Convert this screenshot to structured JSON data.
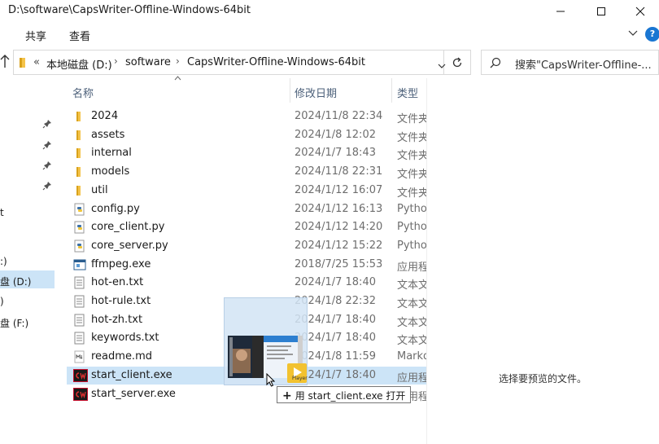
{
  "window": {
    "title": "D:\\software\\CapsWriter-Offline-Windows-64bit"
  },
  "ribbon": {
    "tabs": [
      "共享",
      "查看"
    ],
    "help": "?"
  },
  "address": {
    "overflow": "«",
    "crumbs": [
      "本地磁盘 (D:)",
      "software",
      "CapsWriter-Offline-Windows-64bit"
    ]
  },
  "search": {
    "placeholder": "搜索\"CapsWriter-Offline-..."
  },
  "nav": {
    "items": [
      {
        "label": "t"
      },
      {
        "label": ":)"
      },
      {
        "label": "盘 (D:)"
      },
      {
        "label": ")"
      },
      {
        "label": "盘 (F:)"
      }
    ]
  },
  "columns": {
    "name": "名称",
    "date": "修改日期",
    "type": "类型"
  },
  "files": [
    {
      "name": "2024",
      "date": "2024/11/8 22:34",
      "type": "文件夹",
      "icon": "folder-icon"
    },
    {
      "name": "assets",
      "date": "2024/1/8 12:02",
      "type": "文件夹",
      "icon": "folder-icon"
    },
    {
      "name": "internal",
      "date": "2024/1/7 18:43",
      "type": "文件夹",
      "icon": "folder-icon"
    },
    {
      "name": "models",
      "date": "2024/11/8 22:31",
      "type": "文件夹",
      "icon": "folder-icon"
    },
    {
      "name": "util",
      "date": "2024/1/12 16:07",
      "type": "文件夹",
      "icon": "folder-icon"
    },
    {
      "name": "config.py",
      "date": "2024/1/12 16:13",
      "type": "Python",
      "icon": "python-file-icon"
    },
    {
      "name": "core_client.py",
      "date": "2024/1/12 14:20",
      "type": "Python",
      "icon": "python-file-icon"
    },
    {
      "name": "core_server.py",
      "date": "2024/1/12 15:22",
      "type": "Python",
      "icon": "python-file-icon"
    },
    {
      "name": "ffmpeg.exe",
      "date": "2018/7/25 15:53",
      "type": "应用程序",
      "icon": "exe-window-icon"
    },
    {
      "name": "hot-en.txt",
      "date": "2024/1/7 18:40",
      "type": "文本文档",
      "icon": "text-file-icon"
    },
    {
      "name": "hot-rule.txt",
      "date": "2024/1/8 22:32",
      "type": "文本文档",
      "icon": "text-file-icon"
    },
    {
      "name": "hot-zh.txt",
      "date": "2024/1/7 18:40",
      "type": "文本文档",
      "icon": "text-file-icon"
    },
    {
      "name": "keywords.txt",
      "date": "2024/1/7 18:40",
      "type": "文本文档",
      "icon": "text-file-icon"
    },
    {
      "name": "readme.md",
      "date": "2024/1/8 11:59",
      "type": "Markdown",
      "icon": "markdown-file-icon"
    },
    {
      "name": "start_client.exe",
      "date": "2024/1/7 18:40",
      "type": "应用程序",
      "icon": "capswriter-exe-icon",
      "highlighted": true
    },
    {
      "name": "start_server.exe",
      "date": "",
      "type": "应用程序",
      "icon": "capswriter-exe-icon"
    }
  ],
  "preview": {
    "empty_text": "选择要预览的文件。"
  },
  "drag": {
    "tooltip": "用 start_client.exe 打开",
    "badge": "Player"
  },
  "colors": {
    "selection": "#cce4f7",
    "folder": "#f4c34a",
    "accent": "#1976d2",
    "capswriter_red": "#c8102e"
  }
}
